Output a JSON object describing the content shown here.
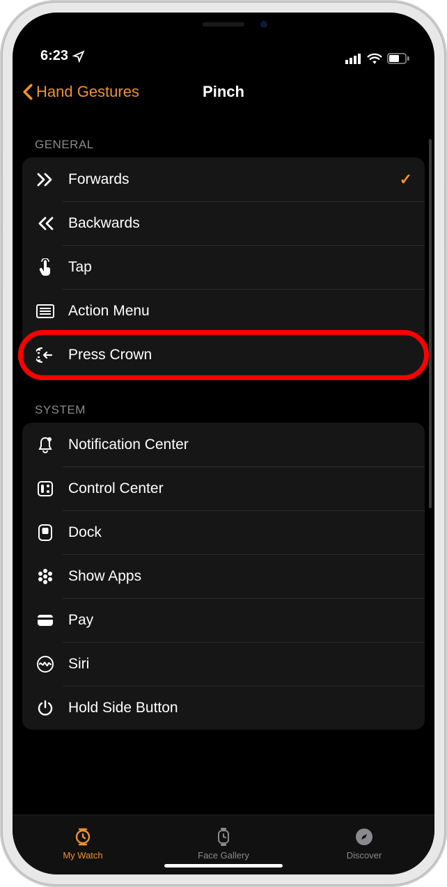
{
  "status": {
    "time": "6:23"
  },
  "nav": {
    "back_label": "Hand Gestures",
    "title": "Pinch"
  },
  "sections": [
    {
      "header": "GENERAL",
      "rows": [
        {
          "icon": "chevrons-right",
          "label": "Forwards",
          "selected": true
        },
        {
          "icon": "chevrons-left",
          "label": "Backwards",
          "selected": false
        },
        {
          "icon": "tap-hand",
          "label": "Tap",
          "selected": false
        },
        {
          "icon": "action-menu",
          "label": "Action Menu",
          "selected": false
        },
        {
          "icon": "press-crown",
          "label": "Press Crown",
          "selected": false,
          "highlighted": true
        }
      ]
    },
    {
      "header": "SYSTEM",
      "rows": [
        {
          "icon": "bell",
          "label": "Notification Center",
          "selected": false
        },
        {
          "icon": "control-center",
          "label": "Control Center",
          "selected": false
        },
        {
          "icon": "dock",
          "label": "Dock",
          "selected": false
        },
        {
          "icon": "apps-grid",
          "label": "Show Apps",
          "selected": false
        },
        {
          "icon": "wallet",
          "label": "Pay",
          "apple_prefix": true,
          "selected": false
        },
        {
          "icon": "siri",
          "label": "Siri",
          "selected": false
        },
        {
          "icon": "power",
          "label": "Hold Side Button",
          "selected": false
        }
      ]
    }
  ],
  "tabs": [
    {
      "icon": "watch",
      "label": "My Watch",
      "active": true
    },
    {
      "icon": "face-gallery",
      "label": "Face Gallery",
      "active": false
    },
    {
      "icon": "discover",
      "label": "Discover",
      "active": false
    }
  ],
  "colors": {
    "accent": "#f0932b",
    "highlight": "#ff0000"
  }
}
